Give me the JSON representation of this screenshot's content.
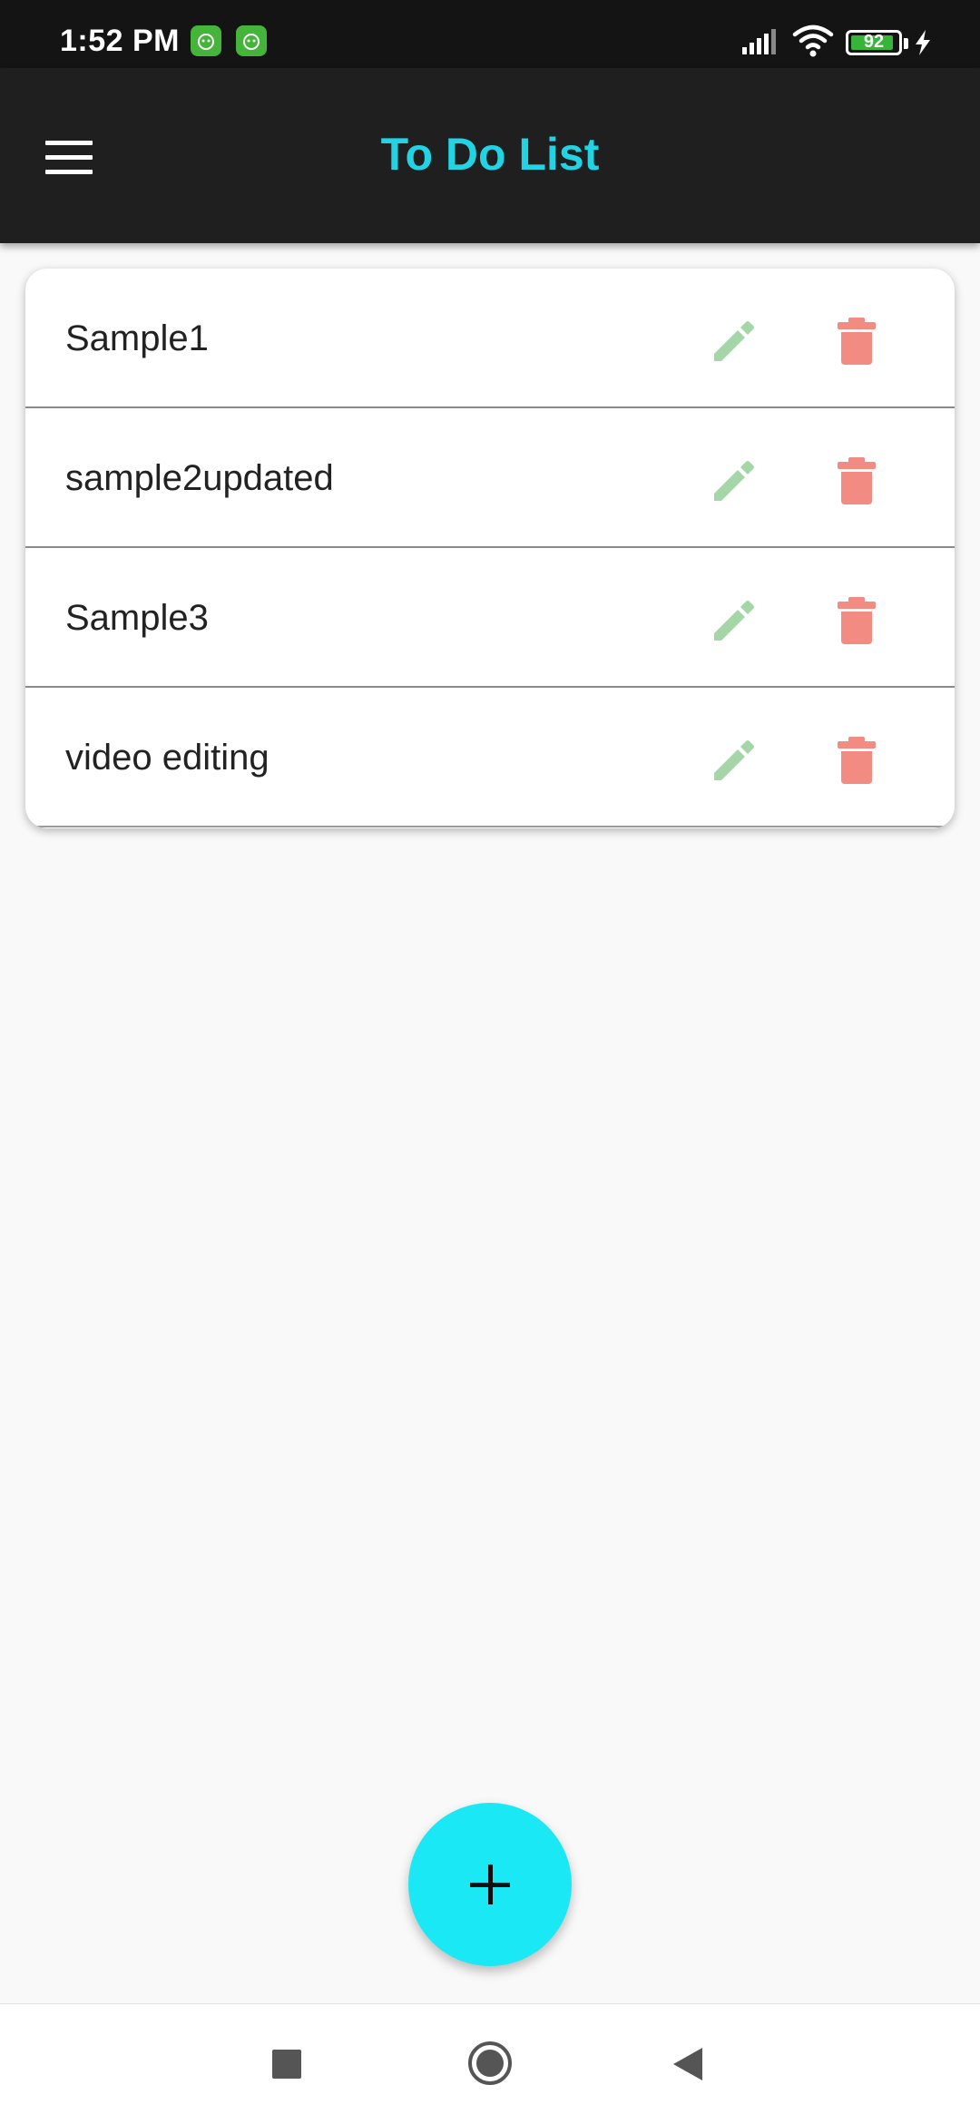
{
  "status_bar": {
    "time": "1:52 PM",
    "battery_level": "92",
    "battery_fraction": 0.92,
    "icons": [
      "app-notification-icon",
      "app-notification-icon",
      "signal-icon",
      "wifi-icon",
      "battery-icon",
      "charging-bolt-icon"
    ]
  },
  "app_bar": {
    "title": "To Do List",
    "menu_icon": "hamburger-menu-icon"
  },
  "colors": {
    "title": "#22d3e4",
    "app_bar": "#1f1f1f",
    "edit_icon": "#a5d6a7",
    "delete_icon": "#f28b82",
    "fab": "#1ae8f5"
  },
  "todos": [
    {
      "label": "Sample1"
    },
    {
      "label": "sample2updated"
    },
    {
      "label": "Sample3"
    },
    {
      "label": "video editing"
    }
  ],
  "row_actions": {
    "edit_icon": "pencil-icon",
    "delete_icon": "trash-icon"
  },
  "fab": {
    "icon": "plus-icon"
  },
  "nav_bar": {
    "icons": [
      "recents-square-icon",
      "home-circle-icon",
      "back-triangle-icon"
    ]
  }
}
